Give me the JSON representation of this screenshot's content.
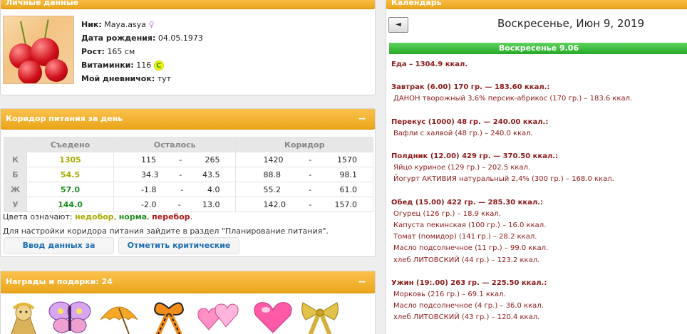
{
  "personal": {
    "header": "Личные данные",
    "nick_label": "Ник:",
    "nick_value": "Maya.asya",
    "gender_symbol": "♀",
    "birth_label": "Дата рождения:",
    "birth_value": "04.05.1973",
    "height_label": "Рост:",
    "height_value": "165 см",
    "vitamins_label": "Витаминки:",
    "vitamins_value": "116",
    "vitamins_badge": "C",
    "diary_label": "Мой дневничок:",
    "diary_value": "тут"
  },
  "corridor": {
    "header": "Коридор питания за день",
    "collapse": "−",
    "columns": [
      "Съедено",
      "Осталось",
      "Коридор"
    ],
    "rows": [
      {
        "label": "К",
        "eaten": "1305",
        "left_min": "115",
        "left_max": "265",
        "cor_min": "1420",
        "cor_max": "1570"
      },
      {
        "label": "Б",
        "eaten": "54.5",
        "left_min": "34.3",
        "left_max": "43.5",
        "cor_min": "88.8",
        "cor_max": "98.1"
      },
      {
        "label": "Ж",
        "eaten": "57.0",
        "left_min": "-1.8",
        "left_max": "4.0",
        "cor_min": "55.2",
        "cor_max": "61.0"
      },
      {
        "label": "У",
        "eaten": "144.0",
        "left_min": "-2.0",
        "left_max": "13.0",
        "cor_min": "142.0",
        "cor_max": "157.0"
      }
    ],
    "dash": "-",
    "legend_prefix": "Цвета означают:",
    "legend_low": "недобор",
    "legend_ok": "норма",
    "legend_over": "перебор",
    "hint": "Для настройки коридора питания зайдите в раздел \"Планирование питания\".",
    "btn_today": "Ввод данных за сегодня",
    "btn_critical": "Отметить критические дни"
  },
  "awards": {
    "header": "Награды и подарки: 24",
    "collapse": "−"
  },
  "calendar": {
    "header": "Календарь",
    "nav_prev": "◄",
    "title": "Воскресенье, Июн 9, 2019",
    "day": "Воскресенье 9.06",
    "food_total": "Еда – 1304.9 ккал.",
    "meals": [
      {
        "title": "Завтрак (6.00) 170 гр. — 183.60 ккал.:",
        "items": [
          "ДАНОН творожный 3,6% персик-абрикос (170 гр.) – 183.6 ккал."
        ]
      },
      {
        "title": "Перекус (1000) 48 гр. — 240.00 ккал.:",
        "items": [
          "Вафли с халвой (48 гр.) – 240.0 ккал."
        ]
      },
      {
        "title": "Полдник (12.00) 429 гр. — 370.50 ккал.:",
        "items": [
          "Яйцо куриное (129 гр.) – 202.5 ккал.",
          "Йогурт АКТИВИЯ натуральный 2,4% (300 гр.) – 168.0 ккал."
        ]
      },
      {
        "title": "Обед (15.00) 422 гр. — 285.30 ккал.:",
        "items": [
          "Огурец (126 гр.) – 18.9 ккал.",
          "Капуста пекинская (100 гр.) – 16.0 ккал.",
          "Томат (помидор) (141 гр.) – 28.2 ккал.",
          "Масло подсолнечное (11 гр.) – 99.0 ккал.",
          "хлеб ЛИТОВСКИЙ (44 гр.) – 123.2 ккал."
        ]
      },
      {
        "title": "Ужин (19:.00) 263 гр. — 225.50 ккал.:",
        "items": [
          "Морковь (216 гр.) – 69.1 ккал.",
          "Масло подсолнечное (4 гр.) – 36.0 ккал.",
          "хлеб ЛИТОВСКИЙ (43 гр.) – 120.4 ккал."
        ]
      }
    ]
  }
}
